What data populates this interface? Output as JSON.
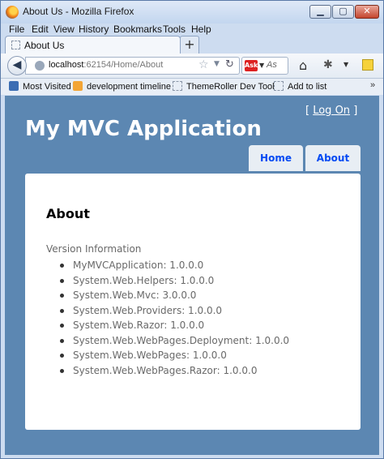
{
  "window": {
    "title": "About Us - Mozilla Firefox"
  },
  "menu": [
    "File",
    "Edit",
    "View",
    "History",
    "Bookmarks",
    "Tools",
    "Help"
  ],
  "tabs": [
    {
      "label": "About Us"
    }
  ],
  "new_tab_glyph": "+",
  "nav": {
    "url_host": "localhost",
    "url_rest": ":62154/Home/About",
    "search_placeholder": "As"
  },
  "bookmarks": [
    {
      "label": "Most Visited",
      "icon": "most-visited-icon"
    },
    {
      "label": "development timeline",
      "icon": "rss-icon"
    },
    {
      "label": "ThemeRoller Dev Tool",
      "icon": "page-icon"
    },
    {
      "label": "Add to list",
      "icon": "page-icon"
    }
  ],
  "page": {
    "login_open": "[",
    "login_link": "Log On",
    "login_close": "]",
    "site_title": "My MVC Application",
    "menu_tabs": [
      "Home",
      "About"
    ],
    "heading": "About",
    "version_label": "Version Information",
    "libraries": [
      "MyMVCApplication: 1.0.0.0",
      "System.Web.Helpers: 1.0.0.0",
      "System.Web.Mvc: 3.0.0.0",
      "System.Web.Providers: 1.0.0.0",
      "System.Web.Razor: 1.0.0.0",
      "System.Web.WebPages.Deployment: 1.0.0.0",
      "System.Web.WebPages: 1.0.0.0",
      "System.Web.WebPages.Razor: 1.0.0.0"
    ]
  },
  "colors": {
    "page_background": "#5c87b2",
    "menu_tab_text": "#034af3",
    "content_text": "#696969"
  }
}
